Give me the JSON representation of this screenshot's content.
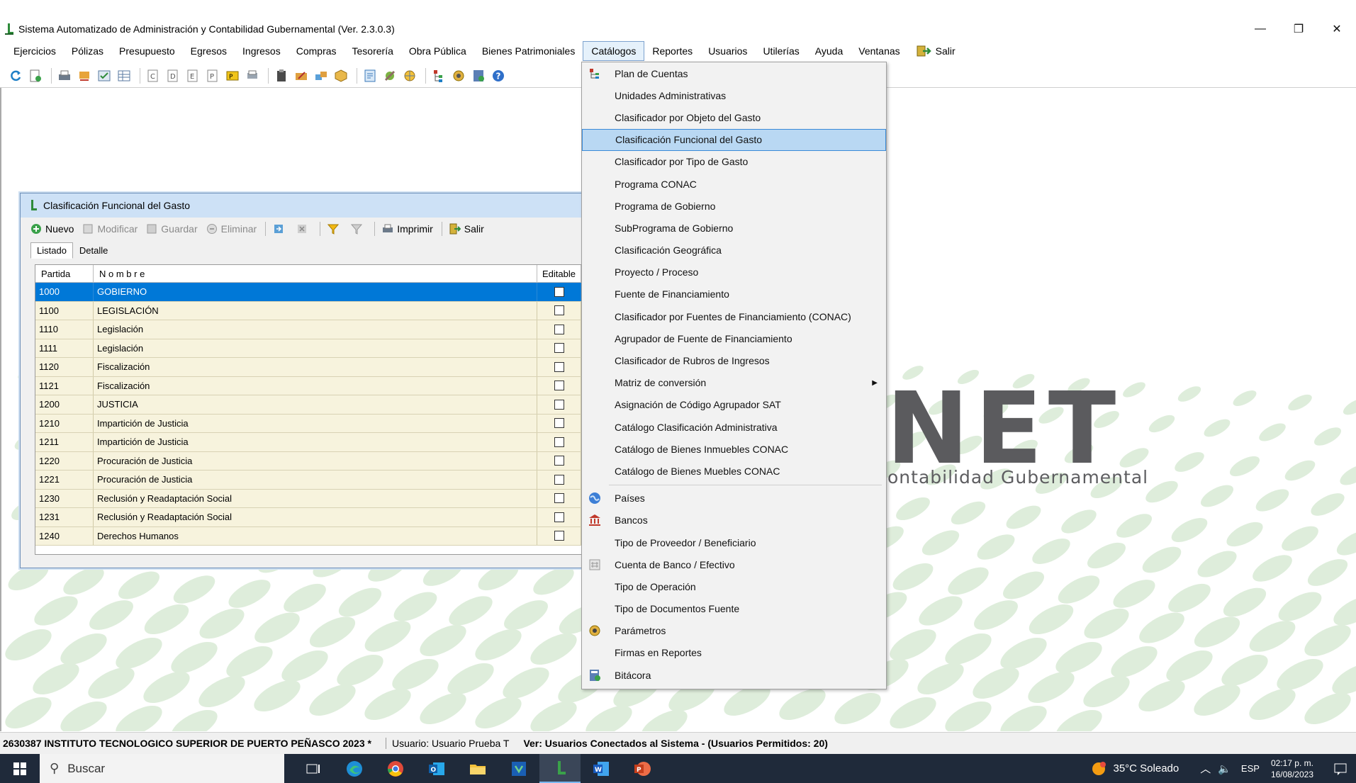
{
  "titlebar": {
    "title": "Sistema Automatizado de Administración y Contabilidad Gubernamental  (Ver. 2.3.0.3)",
    "minimize_glyph": "—",
    "restore_glyph": "❐",
    "close_glyph": "✕"
  },
  "menubar": {
    "items": [
      "Ejercicios",
      "Pólizas",
      "Presupuesto",
      "Egresos",
      "Ingresos",
      "Compras",
      "Tesorería",
      "Obra Pública",
      "Bienes Patrimoniales",
      "Catálogos",
      "Reportes",
      "Usuarios",
      "Utilerías",
      "Ayuda",
      "Ventanas"
    ],
    "exit_label": "Salir",
    "active": "Catálogos"
  },
  "background": {
    "logo_text": "NET",
    "logo_subtitle": "ontabilidad Gubernamental"
  },
  "child_window": {
    "title": "Clasificación Funcional del Gasto",
    "toolbar": {
      "nuevo": "Nuevo",
      "modificar": "Modificar",
      "guardar": "Guardar",
      "eliminar": "Eliminar",
      "imprimir": "Imprimir",
      "salir": "Salir"
    },
    "tabs": [
      "Listado",
      "Detalle"
    ],
    "columns": [
      "Partida",
      "N o m b r e",
      "Editable"
    ],
    "rows": [
      {
        "partida": "1000",
        "nombre": "GOBIERNO"
      },
      {
        "partida": "1100",
        "nombre": "LEGISLACIÓN"
      },
      {
        "partida": "1110",
        "nombre": "Legislación"
      },
      {
        "partida": "1111",
        "nombre": "Legislación"
      },
      {
        "partida": "1120",
        "nombre": "Fiscalización"
      },
      {
        "partida": "1121",
        "nombre": "Fiscalización"
      },
      {
        "partida": "1200",
        "nombre": "JUSTICIA"
      },
      {
        "partida": "1210",
        "nombre": "Impartición de Justicia"
      },
      {
        "partida": "1211",
        "nombre": "Impartición de Justicia"
      },
      {
        "partida": "1220",
        "nombre": "Procuración de Justicia"
      },
      {
        "partida": "1221",
        "nombre": "Procuración de Justicia"
      },
      {
        "partida": "1230",
        "nombre": "Reclusión y Readaptación Social"
      },
      {
        "partida": "1231",
        "nombre": "Reclusión y Readaptación Social"
      },
      {
        "partida": "1240",
        "nombre": "Derechos Humanos"
      }
    ]
  },
  "dropdown": {
    "group1": [
      "Plan de Cuentas",
      "Unidades Administrativas",
      "Clasificador por Objeto del Gasto",
      "Clasificación Funcional del Gasto",
      "Clasificador por Tipo de Gasto",
      "Programa CONAC",
      "Programa de Gobierno",
      "SubPrograma de Gobierno",
      "Clasificación Geográfica",
      "Proyecto / Proceso",
      "Fuente de Financiamiento",
      "Clasificador por Fuentes de Financiamiento (CONAC)",
      "Agrupador de Fuente de Financiamiento",
      "Clasificador de Rubros de Ingresos",
      "Matriz de conversión",
      "Asignación de Código Agrupador SAT",
      "Catálogo Clasificación Administrativa",
      "Catálogo de Bienes Inmuebles CONAC",
      "Catálogo de Bienes Muebles CONAC"
    ],
    "group2": [
      "Países",
      "Bancos",
      "Tipo de Proveedor / Beneficiario",
      "Cuenta de Banco / Efectivo",
      "Tipo de Operación",
      "Tipo de Documentos Fuente",
      "Parámetros",
      "Firmas en Reportes",
      "Bitácora"
    ],
    "highlighted": "Clasificación Funcional del Gasto",
    "submenu_item": "Matriz de conversión"
  },
  "statusbar": {
    "entity": "2630387 INSTITUTO TECNOLOGICO SUPERIOR DE PUERTO PEÑASCO  2023   *",
    "user": "Usuario: Usuario Prueba T",
    "connected": "Ver: Usuarios Conectados al Sistema - (Usuarios Permitidos: 20)"
  },
  "taskbar": {
    "search_placeholder": "Buscar",
    "weather": "35°C  Soleado",
    "language": "ESP",
    "time": "02:17 p. m.",
    "date": "16/08/2023"
  },
  "colors": {
    "selection": "#0078d7",
    "row_bg": "#f7f3dd",
    "menu_highlight": "#b9d8f3",
    "taskbar": "#1f2a3a"
  }
}
